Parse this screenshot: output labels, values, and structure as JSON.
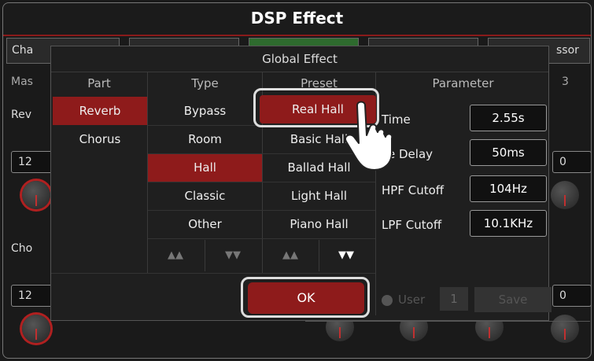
{
  "title": "DSP Effect",
  "tabs": [
    {
      "label": "Cha"
    },
    {
      "label": ""
    },
    {
      "label": ""
    },
    {
      "label": ""
    },
    {
      "label": "ssor"
    }
  ],
  "background": {
    "left_row_label": "Mas",
    "reverb_label": "Rev",
    "left_box_value": "12",
    "chorus_label": "Cho",
    "left_box2_value": "12",
    "right_row_label": "3",
    "right_box_value": "0",
    "right_box2_value": "0"
  },
  "dialog": {
    "title": "Global Effect",
    "columns": {
      "part": "Part",
      "type": "Type",
      "preset": "Preset",
      "parameter": "Parameter"
    },
    "parts": [
      {
        "label": "Reverb",
        "selected": true
      },
      {
        "label": "Chorus",
        "selected": false
      }
    ],
    "types": [
      {
        "label": "Bypass",
        "selected": false
      },
      {
        "label": "Room",
        "selected": false
      },
      {
        "label": "Hall",
        "selected": true
      },
      {
        "label": "Classic",
        "selected": false
      },
      {
        "label": "Other",
        "selected": false
      }
    ],
    "presets": [
      {
        "label": "Real Hall",
        "selected": true
      },
      {
        "label": "Basic Hall",
        "selected": false
      },
      {
        "label": "Ballad Hall",
        "selected": false
      },
      {
        "label": "Light Hall",
        "selected": false
      },
      {
        "label": "Piano Hall",
        "selected": false
      }
    ],
    "parameters": [
      {
        "label": "Time",
        "value": "2.55s"
      },
      {
        "label": "e Delay",
        "value": "50ms"
      },
      {
        "label": "HPF Cutoff",
        "value": "104Hz"
      },
      {
        "label": "LPF Cutoff",
        "value": "10.1KHz"
      }
    ],
    "arrows": {
      "type_up": "▲▲",
      "type_down": "▼▼",
      "preset_up": "▲▲",
      "preset_down": "▼▼"
    },
    "ok_label": "OK",
    "user_label": "User",
    "user_number": "1",
    "save_label": "Save"
  },
  "colors": {
    "accent_red": "#8e1b1b",
    "active_tab_green": "#2e6b2e"
  }
}
